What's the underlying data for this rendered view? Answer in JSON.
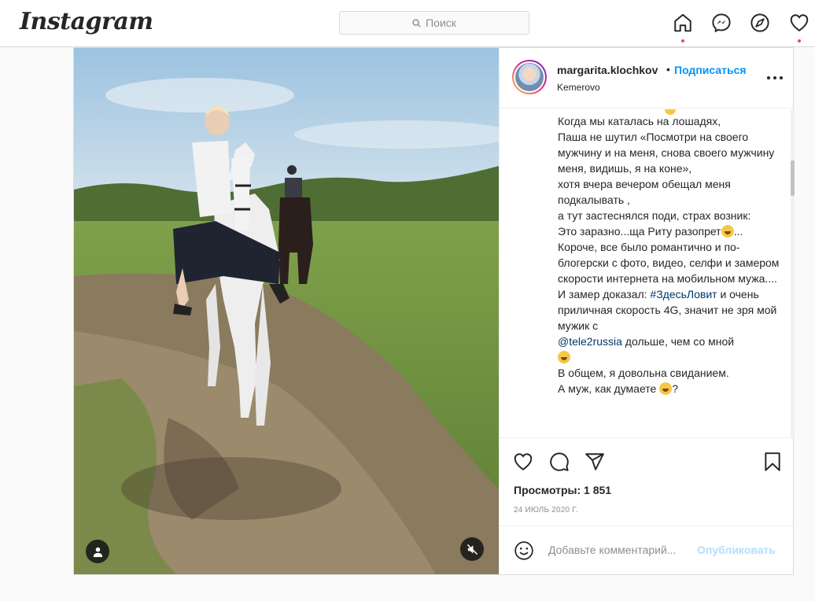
{
  "header": {
    "logo": "Instagram",
    "search_placeholder": "Поиск",
    "nav": [
      "home-icon",
      "messenger-icon",
      "explore-icon",
      "activity-heart-icon"
    ]
  },
  "post": {
    "username": "margarita.klochkov",
    "separator": "•",
    "follow_label": "Подписаться",
    "location": "Kemerovo",
    "caption": {
      "part1": "Когда мы каталась на лошадях,\nПаша не шутил «Посмотри на своего мужчину и на меня, снова своего мужчину меня, видишь, я на коне»,\nхотя вчера вечером обещал меня подкалывать ,\nа тут застеснялся поди, страх возник:\nЭто заразно...ща Риту разопрет",
      "part2": "...\nКороче, все было романтично и по-блогерски с фото, видео, селфи и замером скорости интернета на мобильном мужа....\nИ замер доказал: ",
      "hashtag": "#ЗдесьЛовит",
      "part3": " и очень приличная скорость 4G, значит не зря мой мужик с\n",
      "mention": "@tele2russia",
      "part4": " дольше, чем со мной\n",
      "part5": "\nВ общем, я довольна свиданием.\nА муж, как думаете ",
      "part6": "?"
    },
    "views": "Просмотры: 1 851",
    "date": "24 ИЮЛЬ 2020 Г.",
    "comment_placeholder": "Добавьте комментарий...",
    "publish_label": "Опубликовать"
  },
  "colors": {
    "accent": "#0095f6",
    "publish_disabled": "#b2dffc",
    "notification_dot": "#ed4956"
  }
}
